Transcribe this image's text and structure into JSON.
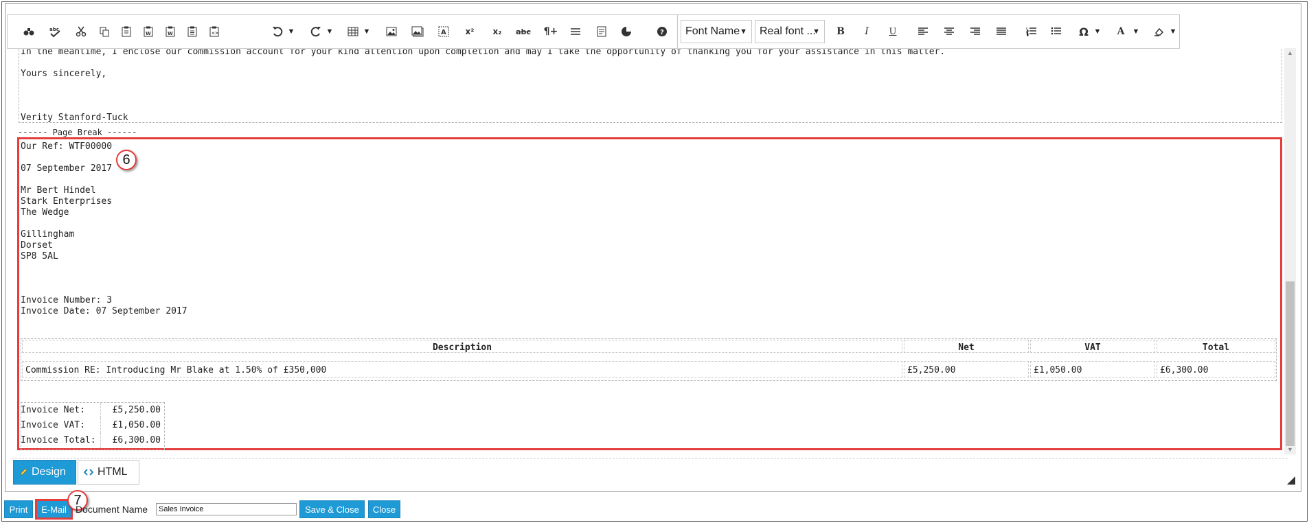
{
  "toolbar": {
    "font_name": "Font Name",
    "font_size": "Real font ...",
    "bold": "B",
    "italic": "I",
    "underline": "U",
    "omega": "Ω",
    "font_color": "A",
    "superscript": "x²",
    "subscript": "x₂",
    "strike": "abc",
    "paragraph": "¶+",
    "help": "?"
  },
  "previous_page": {
    "line1": "In the meantime, I enclose our commission account for your kind attention upon completion and may I take the opportunity of thanking you for your assistance in this matter.",
    "line2": "Yours sincerely,",
    "signature": "Verity Stanford-Tuck"
  },
  "page_break": "------ Page Break ------",
  "invoice": {
    "our_ref": "Our Ref: WTF00000",
    "date": "07 September 2017",
    "address": [
      "Mr Bert Hindel",
      "Stark Enterprises",
      "The Wedge",
      "",
      "Gillingham",
      "Dorset",
      "SP8 5AL"
    ],
    "invoice_number": "Invoice Number: 3",
    "invoice_date": "Invoice Date: 07 September 2017",
    "table": {
      "headers": [
        "Description",
        "Net",
        "VAT",
        "Total"
      ],
      "row": [
        "Commission RE: Introducing Mr Blake at 1.50% of £350,000",
        "£5,250.00",
        "£1,050.00",
        "£6,300.00"
      ]
    },
    "totals": [
      {
        "label": "Invoice Net:",
        "value": "£5,250.00"
      },
      {
        "label": "Invoice VAT:",
        "value": "£1,050.00"
      },
      {
        "label": "Invoice Total:",
        "value": "£6,300.00"
      }
    ]
  },
  "callouts": {
    "six": "6",
    "seven": "7"
  },
  "modes": {
    "design": "Design",
    "html": "HTML"
  },
  "footer": {
    "print": "Print",
    "email": "E-Mail",
    "doc_name_label": "Document Name",
    "doc_name_value": "Sales Invoice",
    "save_close": "Save & Close",
    "close": "Close"
  },
  "colors": {
    "accent": "#1e9ad6",
    "highlight": "#e53c3c"
  }
}
